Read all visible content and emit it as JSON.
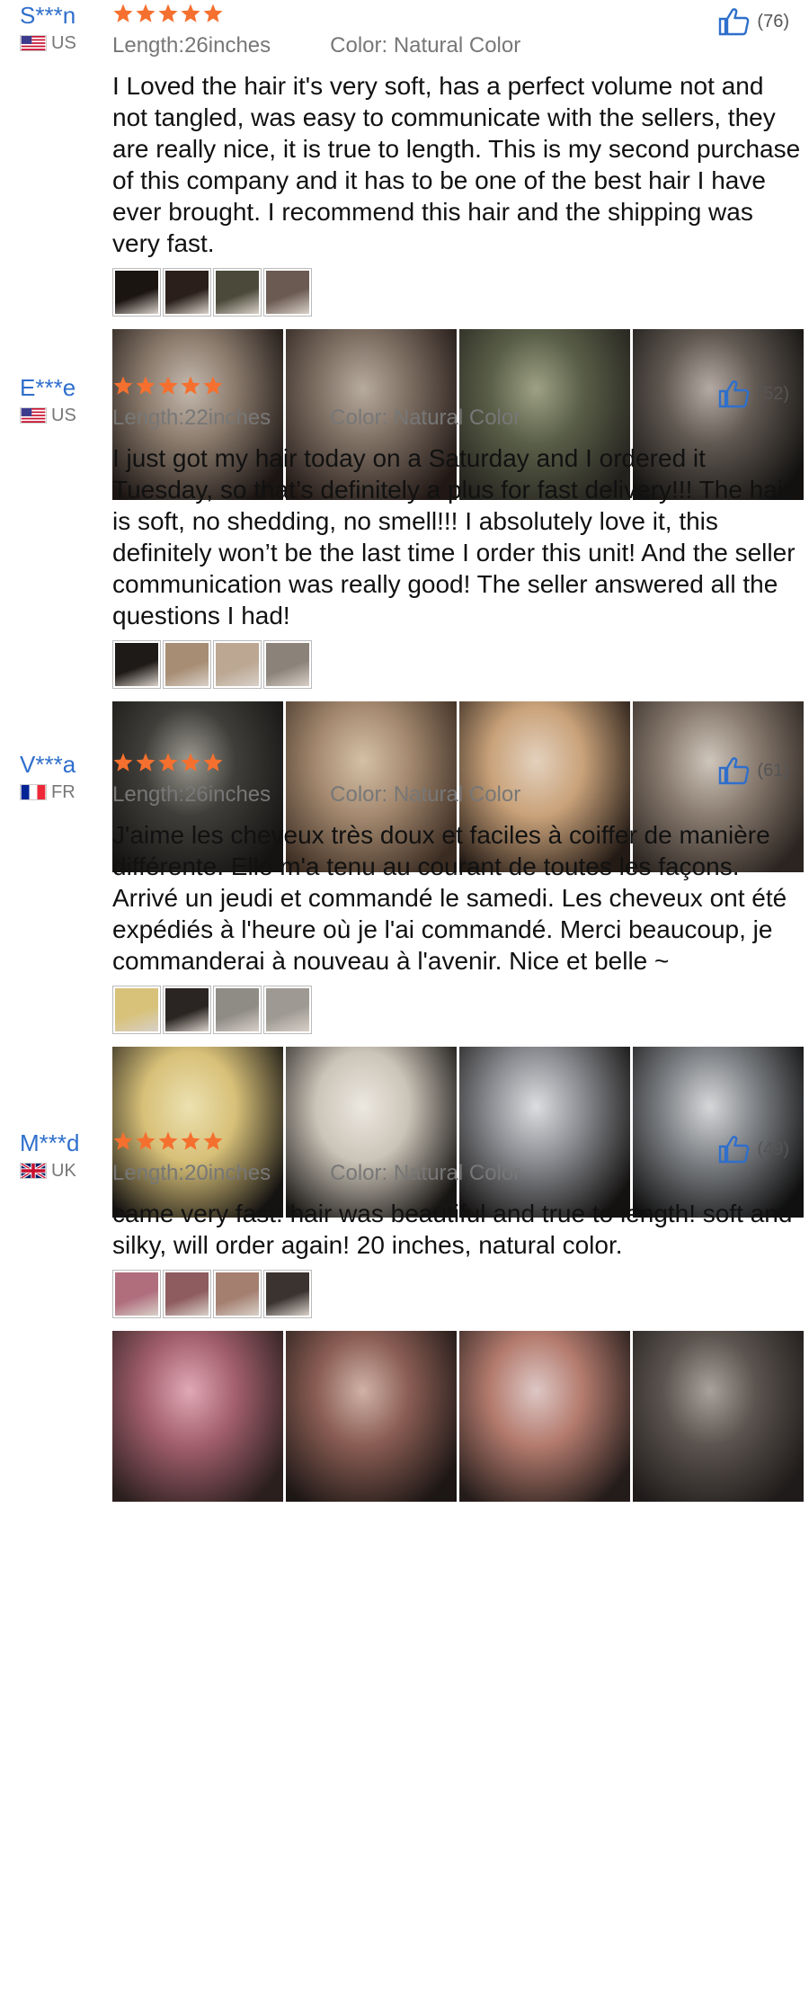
{
  "colors": {
    "username": "#2f6fcc",
    "star": "#f5702e",
    "meta": "#777777",
    "text": "#111111"
  },
  "reviews": [
    {
      "username": "S***n",
      "country": "US",
      "flag": "us-flag-icon",
      "rating": 5,
      "likes": "(76)",
      "length": "Length:26inches",
      "color": "Color: Natural Color",
      "text": "I Loved the hair it's very soft, has a perfect volume not and not tangled, was easy to communicate with the sellers, they are really nice, it is true to length. This is my second purchase of this company and it has to be one of the best hair I have ever brought. I recommend this hair and the shipping was very fast.",
      "thumbs": [
        "#1b1512",
        "#2a1f1a",
        "#4b4a3a",
        "#6b5a52"
      ],
      "photos": [
        [
          "#1a1412",
          "#8a7a6c",
          "#c4b8ad"
        ],
        [
          "#211815",
          "#7d6e62",
          "#b7ab9e"
        ],
        [
          "#23211d",
          "#5a5f48",
          "#9ea184"
        ],
        [
          "#121110",
          "#605851",
          "#b4aaa3"
        ]
      ]
    },
    {
      "username": "E***e",
      "country": "US",
      "flag": "us-flag-icon",
      "rating": 5,
      "likes": "(52)",
      "length": "Length:22inches",
      "color": "Color: Natural Color",
      "text": "I just got my hair today on a Saturday and I ordered it Tuesday, so that’s definitely a plus for fast delivery!!! The hair is soft, no shedding, no smell!!! I absolutely love it, this definitely won’t be the last time I order this unit! And the seller communication was really good! The seller answered all the questions I had!",
      "thumbs": [
        "#1e1a17",
        "#a78d73",
        "#bba792",
        "#8b8279"
      ],
      "photos": [
        [
          "#151312",
          "#3f3e3a",
          "#9c9a90"
        ],
        [
          "#3b2c22",
          "#a58a70",
          "#d4c0a6"
        ],
        [
          "#231a15",
          "#c9a27a",
          "#e3d1bd"
        ],
        [
          "#2b2420",
          "#8a7c70",
          "#cfc6bb"
        ]
      ]
    },
    {
      "username": "V***a",
      "country": "FR",
      "flag": "fr-flag-icon",
      "rating": 5,
      "likes": "(61)",
      "length": "Length:26inches",
      "color": "Color: Natural Color",
      "text": "J'aime les cheveux très doux et faciles à coiffer de manière différente. Elle m'a tenu au courant de toutes les façons. Arrivé un jeudi et commandé le samedi. Les cheveux ont été expédiés à l'heure où je l'ai commandé. Merci beaucoup, je commanderai à nouveau à l'avenir. Nice et belle ~",
      "thumbs": [
        "#d8c27a",
        "#2a2522",
        "#8f8c86",
        "#9e9a93"
      ],
      "photos": [
        [
          "#151312",
          "#d7c078",
          "#ece1b0"
        ],
        [
          "#171513",
          "#cbc4b8",
          "#ece8e0"
        ],
        [
          "#141211",
          "#8b8d92",
          "#dcdde0"
        ],
        [
          "#101010",
          "#7f8286",
          "#d6d7d9"
        ]
      ]
    },
    {
      "username": "M***d",
      "country": "UK",
      "flag": "uk-flag-icon",
      "rating": 5,
      "likes": "(49)",
      "length": "Length:20inches",
      "color": "Color: Natural Color",
      "text": "came very fast! hair was beautiful and true to length! soft and silky, will order again! 20 inches, natural color.",
      "thumbs": [
        "#b06e7d",
        "#8e5b5e",
        "#a47f70",
        "#3a3330"
      ],
      "photos": [
        [
          "#2a1f1d",
          "#a35f6d",
          "#e0a9b5"
        ],
        [
          "#1c1614",
          "#8a5d54",
          "#d0b2a6"
        ],
        [
          "#241c1a",
          "#b47b6e",
          "#ddc7c5"
        ],
        [
          "#1f1b1a",
          "#5b544f",
          "#a9a19a"
        ]
      ]
    }
  ]
}
